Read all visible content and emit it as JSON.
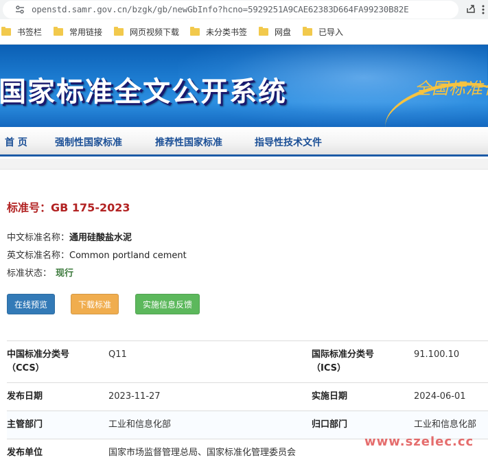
{
  "browser": {
    "url": "openstd.samr.gov.cn/bzgk/gb/newGbInfo?hcno=5929251A9CAE62383D664FA99230B82E",
    "bookmarks": [
      "书签栏",
      "常用链接",
      "网页视频下载",
      "未分类书签",
      "网盘",
      "已导入"
    ]
  },
  "banner": {
    "title": "国家标准全文公开系统",
    "calligraphy": "全国标准化"
  },
  "nav": [
    "首 页",
    "强制性国家标准",
    "推荐性国家标准",
    "指导性技术文件"
  ],
  "standard": {
    "number_label": "标准号：",
    "number": "GB 175-2023",
    "cn_name_label": "中文标准名称：",
    "cn_name": "通用硅酸盐水泥",
    "en_name_label": "英文标准名称：",
    "en_name": "Common portland cement",
    "status_label": "标准状态：",
    "status": "现行"
  },
  "buttons": {
    "preview": "在线预览",
    "download": "下载标准",
    "feedback": "实施信息反馈"
  },
  "table": {
    "ccs_label_1": "中国标准分类号",
    "ccs_label_2": "（CCS）",
    "ccs_value": "Q11",
    "ics_label_1": "国际标准分类号",
    "ics_label_2": "（ICS）",
    "ics_value": "91.100.10",
    "publish_date_label": "发布日期",
    "publish_date": "2023-11-27",
    "impl_date_label": "实施日期",
    "impl_date": "2024-06-01",
    "dept_label": "主管部门",
    "dept": "工业和信息化部",
    "central_label": "归口部门",
    "central": "工业和信息化部",
    "issuer_label": "发布单位",
    "issuer": "国家市场监督管理总局、国家标准化管理委员会"
  },
  "watermark": "www.szelec.cc",
  "colors": {
    "title_red": "#b22222",
    "nav_blue": "#1b4f96",
    "status_green": "#3c7a3c"
  }
}
